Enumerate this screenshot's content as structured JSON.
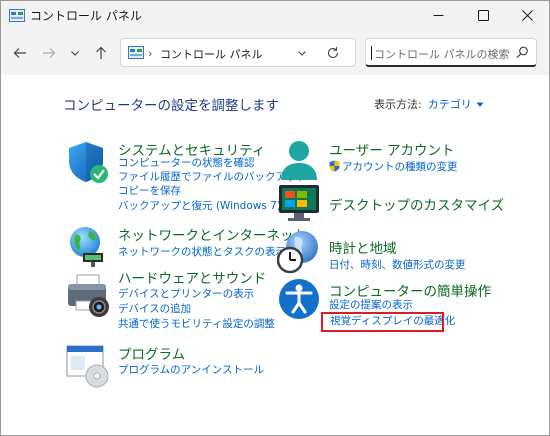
{
  "window": {
    "title": "コントロール パネル",
    "controls": {
      "minimize": "minimize-icon",
      "maximize": "maximize-icon",
      "close": "close-icon"
    }
  },
  "nav": {
    "back": "back-arrow-icon",
    "forward": "forward-arrow-icon",
    "recent": "chevron-down-icon",
    "up": "up-arrow-icon",
    "address_text": "コントロール パネル",
    "search_placeholder": "コントロール パネルの検索"
  },
  "content": {
    "title": "コンピューターの設定を調整します",
    "view_by_label": "表示方法:",
    "view_by_value": "カテゴリ"
  },
  "categories": [
    {
      "title": "システムとセキュリティ",
      "icon": "shield-icon",
      "links": [
        "コンピューターの状態を確認",
        "ファイル履歴でファイルのバックアップ",
        "コピーを保存",
        "バックアップと復元 (Windows 7)"
      ]
    },
    {
      "title": "ネットワークとインターネット",
      "icon": "network-globe-icon",
      "links": [
        "ネットワークの状態とタスクの表示"
      ]
    },
    {
      "title": "ハードウェアとサウンド",
      "icon": "printer-icon",
      "links": [
        "デバイスとプリンターの表示",
        "デバイスの追加",
        "共通で使うモビリティ設定の調整"
      ]
    },
    {
      "title": "プログラム",
      "icon": "programs-icon",
      "links": [
        "プログラムのアンインストール"
      ]
    },
    {
      "title": "ユーザー アカウント",
      "icon": "user-icon",
      "links": [
        "アカウントの種類の変更"
      ]
    },
    {
      "title": "デスクトップのカスタマイズ",
      "icon": "desktop-icon",
      "links": []
    },
    {
      "title": "時計と地域",
      "icon": "clock-globe-icon",
      "links": [
        "日付、時刻、数値形式の変更"
      ]
    },
    {
      "title": "コンピューターの簡単操作",
      "icon": "accessibility-icon",
      "links": [
        "設定の提案の表示",
        "視覚ディスプレイの最適化"
      ]
    }
  ],
  "colors": {
    "title_green": "#0a6b21",
    "link_blue": "#0066cc",
    "heading_blue": "#1e3f87",
    "highlight_red": "#e01b24"
  }
}
